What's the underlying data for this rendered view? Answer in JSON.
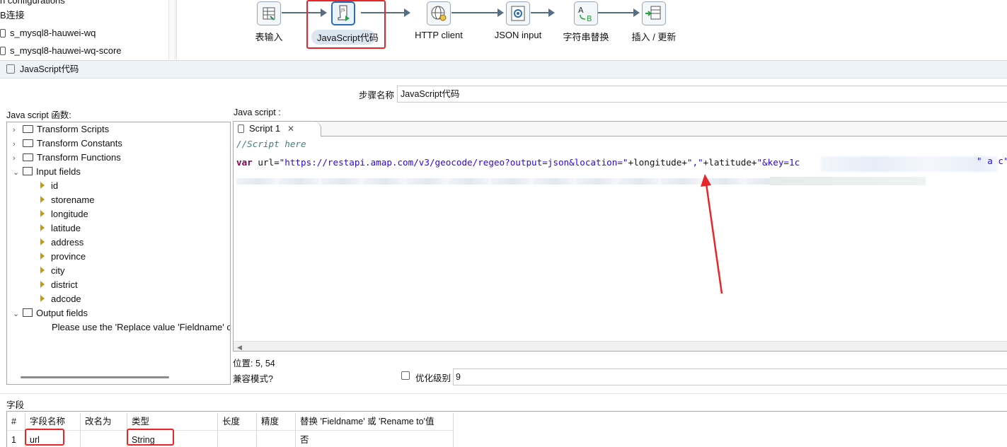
{
  "repo_tree": {
    "items": [
      "n configurations",
      "B连接",
      "s_mysql8-hauwei-wq",
      "s_mysql8-hauwei-wq-score"
    ]
  },
  "canvas": {
    "steps": [
      "表输入",
      "JavaScript代码",
      "HTTP client",
      "JSON input",
      "字符串替换",
      "插入 / 更新"
    ]
  },
  "dialog": {
    "title": "JavaScript代码",
    "step_name_label": "步骤名称",
    "step_name_value": "JavaScript代码",
    "functions_label": "Java script 函数:",
    "script_label": "Java script :",
    "tree": {
      "transform_scripts": "Transform Scripts",
      "transform_constants": "Transform Constants",
      "transform_functions": "Transform Functions",
      "input_fields": "Input fields",
      "fields": [
        "id",
        "storename",
        "longitude",
        "latitude",
        "address",
        "province",
        "city",
        "district",
        "adcode"
      ],
      "output_fields": "Output fields",
      "output_hint": "Please use the 'Replace value 'Fieldname' o"
    },
    "editor": {
      "tab": "Script 1",
      "comment": "//Script here",
      "code_var": "var",
      "code_mid": " url=",
      "code_str1": "\"https://restapi.amap.com/v3/geocode/regeo?output=json&location=\"",
      "code_plus1": "+longitude+",
      "code_str2": "\",\"",
      "code_plus2": "+latitude+",
      "code_str3": "\"&key=1c",
      "code_tail": "\"",
      "code_tail2": "a",
      "code_tail3": "c\""
    },
    "position": "位置: 5, 54",
    "compat_label": "兼容模式?",
    "optimize_label": "优化级别",
    "optimize_value": "9",
    "fields_label": "字段",
    "table": {
      "headers": [
        "#",
        "字段名称",
        "改名为",
        "类型",
        "长度",
        "精度",
        "替换 'Fieldname' 或 'Rename to'值"
      ],
      "row": [
        "1",
        "url",
        "",
        "String",
        "",
        "",
        "否"
      ]
    }
  },
  "colors": {
    "highlight": "#e8262a",
    "accent": "#2a6db5"
  }
}
